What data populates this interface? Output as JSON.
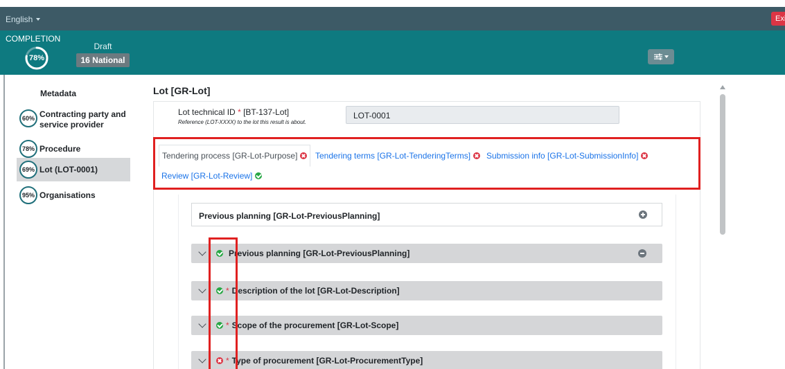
{
  "topbar": {
    "language": "English",
    "exit_label": "Exit"
  },
  "completion": {
    "title": "COMPLETION",
    "percent": "78%",
    "percent_value": 0.78,
    "status": "Draft",
    "badge": "16 National"
  },
  "sidebar": {
    "metadata_label": "Metadata",
    "items": [
      {
        "percent": "60%",
        "label": "Contracting party and service provider"
      },
      {
        "percent": "78%",
        "label": "Procedure"
      },
      {
        "percent": "69%",
        "label": "Lot (LOT-0001)"
      },
      {
        "percent": "95%",
        "label": "Organisations"
      }
    ]
  },
  "main": {
    "title": "Lot [GR-Lot]",
    "technical_id": {
      "label": "Lot technical ID",
      "required": "*",
      "code": "[BT-137-Lot]",
      "hint": "Reference (LOT-XXXX) to the lot this result is about.",
      "value": "LOT-0001"
    },
    "tabs": [
      {
        "label": "Tendering process  [GR-Lot-Purpose]",
        "status": "error"
      },
      {
        "label": "Tendering terms  [GR-Lot-TenderingTerms]",
        "status": "error"
      },
      {
        "label": "Submission info  [GR-Lot-SubmissionInfo]",
        "status": "error"
      },
      {
        "label": "Review  [GR-Lot-Review]",
        "status": "ok"
      }
    ],
    "section_title": "Previous planning  [GR-Lot-PreviousPlanning]",
    "accordions": [
      {
        "label": "Previous planning  [GR-Lot-PreviousPlanning]",
        "required": "",
        "status": "ok"
      },
      {
        "label": "Description of the lot  [GR-Lot-Description]",
        "required": "*",
        "status": "ok"
      },
      {
        "label": "Scope of the procurement  [GR-Lot-Scope]",
        "required": "*",
        "status": "ok"
      },
      {
        "label": "Type of procurement  [GR-Lot-ProcurementType]",
        "required": "*",
        "status": "error"
      }
    ]
  },
  "colors": {
    "topbar": "#3d5a66",
    "banner": "#0e7a80",
    "error": "#dc3545",
    "ok": "#28a745",
    "link": "#1a73e8",
    "highlight": "#e02020"
  }
}
